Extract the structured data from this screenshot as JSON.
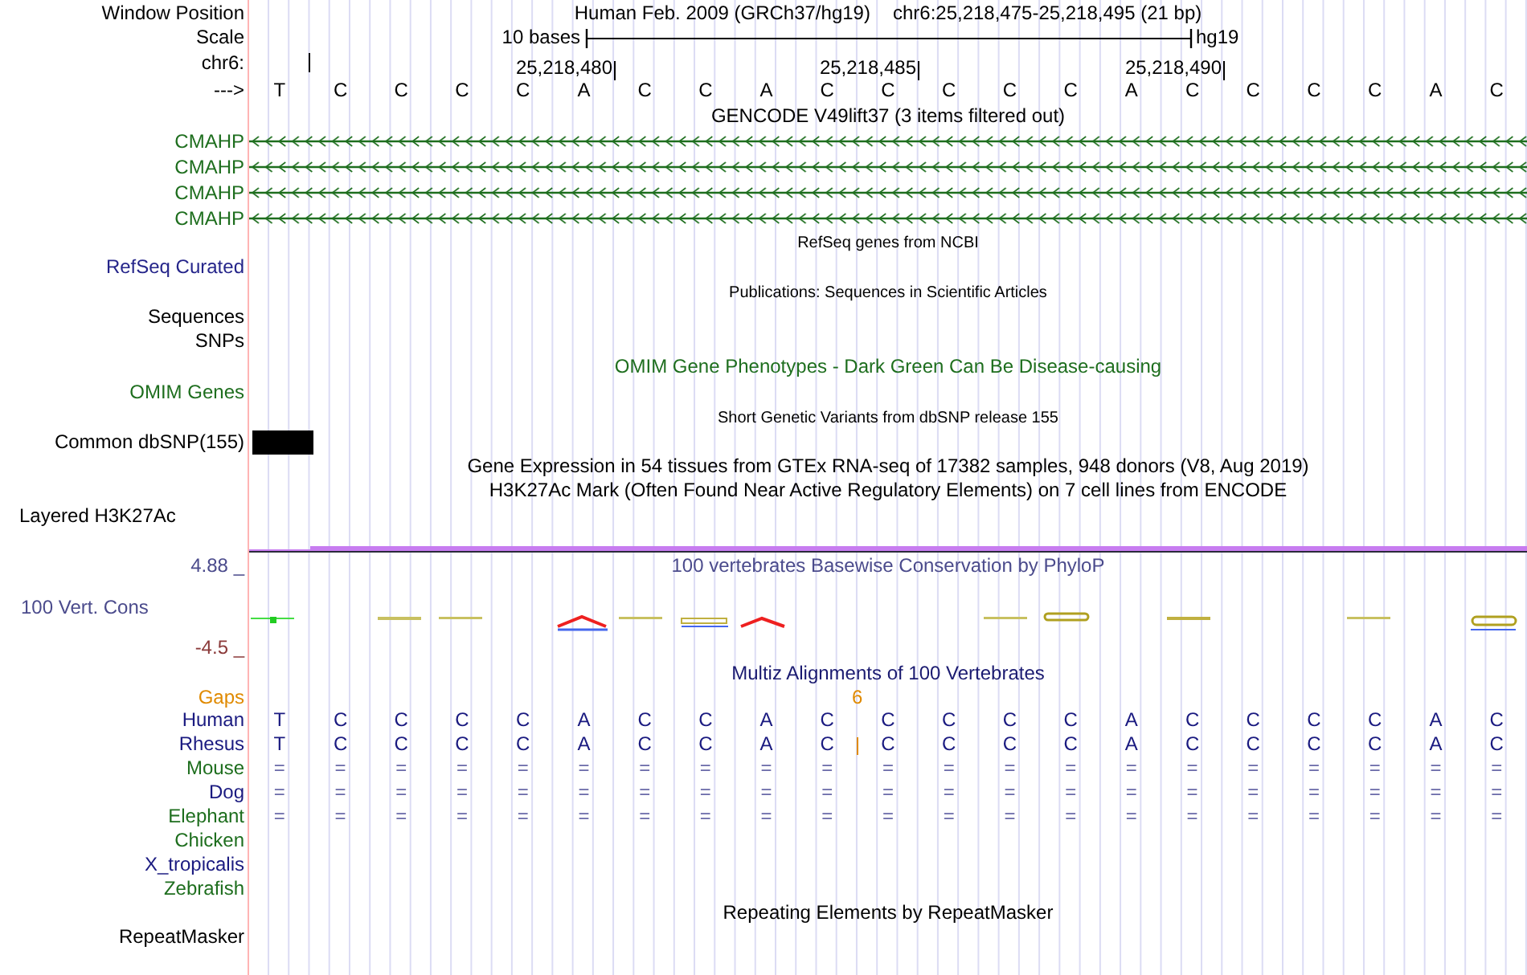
{
  "ruler": {
    "labels": [
      "Window Position",
      "Scale",
      "chr6:",
      "--->"
    ],
    "title": "Human Feb. 2009 (GRCh37/hg19)",
    "position": "chr6:25,218,475-25,218,495 (21 bp)",
    "scale_text": "10 bases",
    "assembly": "hg19",
    "ticks": [
      "25,218,480",
      "25,218,485",
      "25,218,490"
    ],
    "bases": [
      "T",
      "C",
      "C",
      "C",
      "C",
      "A",
      "C",
      "C",
      "A",
      "C",
      "C",
      "C",
      "C",
      "C",
      "A",
      "C",
      "C",
      "C",
      "C",
      "A",
      "C"
    ]
  },
  "gencode": {
    "title": "GENCODE V49lift37 (3 items filtered out)",
    "genes": [
      {
        "name": "CMAHP"
      },
      {
        "name": "CMAHP"
      },
      {
        "name": "CMAHP"
      },
      {
        "name": "CMAHP"
      }
    ]
  },
  "refseq": {
    "title": "RefSeq genes from NCBI",
    "label": "RefSeq Curated"
  },
  "publications": {
    "title": "Publications: Sequences in Scientific Articles",
    "labels": [
      "Sequences",
      "SNPs"
    ]
  },
  "omim": {
    "title": "OMIM Gene Phenotypes - Dark Green Can Be Disease-causing",
    "label": "OMIM Genes"
  },
  "dbsnp": {
    "title": "Short Genetic Variants from dbSNP release 155",
    "label": "Common dbSNP(155)"
  },
  "gtex": {
    "title": "Gene Expression in 54 tissues from GTEx RNA-seq of 17382 samples, 948 donors (V8, Aug 2019)"
  },
  "h3k27ac": {
    "title": "H3K27Ac Mark (Often Found Near Active Regulatory Elements) on 7 cell lines from ENCODE",
    "label": "Layered H3K27Ac"
  },
  "conservation": {
    "title": "100 vertebrates Basewise Conservation by PhyloP",
    "label": "100 Vert. Cons",
    "max": "4.88 _",
    "min": "-4.5 _"
  },
  "multiz": {
    "title": "Multiz Alignments of 100 Vertebrates",
    "gaps_label": "Gaps",
    "gap_count": "6",
    "species": [
      {
        "name": "Human",
        "color": "#1a1a80",
        "kind": "bases",
        "insertion": false,
        "bases": [
          "T",
          "C",
          "C",
          "C",
          "C",
          "A",
          "C",
          "C",
          "A",
          "C",
          "C",
          "C",
          "C",
          "C",
          "A",
          "C",
          "C",
          "C",
          "C",
          "A",
          "C"
        ]
      },
      {
        "name": "Rhesus",
        "color": "#1a1a80",
        "kind": "bases",
        "insertion": true,
        "bases": [
          "T",
          "C",
          "C",
          "C",
          "C",
          "A",
          "C",
          "C",
          "A",
          "C",
          "C",
          "C",
          "C",
          "C",
          "A",
          "C",
          "C",
          "C",
          "C",
          "A",
          "C"
        ]
      },
      {
        "name": "Mouse",
        "color": "#1e6e1e",
        "kind": "bases",
        "insertion": false,
        "bases": [
          "=",
          "=",
          "=",
          "=",
          "=",
          "=",
          "=",
          "=",
          "=",
          "=",
          "=",
          "=",
          "=",
          "=",
          "=",
          "=",
          "=",
          "=",
          "=",
          "=",
          "="
        ]
      },
      {
        "name": "Dog",
        "color": "#1a1a80",
        "kind": "bases",
        "insertion": false,
        "bases": [
          "=",
          "=",
          "=",
          "=",
          "=",
          "=",
          "=",
          "=",
          "=",
          "=",
          "=",
          "=",
          "=",
          "=",
          "=",
          "=",
          "=",
          "=",
          "=",
          "=",
          "="
        ]
      },
      {
        "name": "Elephant",
        "color": "#1e6e1e",
        "kind": "bases",
        "insertion": false,
        "bases": [
          "=",
          "=",
          "=",
          "=",
          "=",
          "=",
          "=",
          "=",
          "=",
          "=",
          "=",
          "=",
          "=",
          "=",
          "=",
          "=",
          "=",
          "=",
          "=",
          "=",
          "="
        ]
      },
      {
        "name": "Chicken",
        "color": "#1e6e1e",
        "kind": "empty",
        "insertion": false
      },
      {
        "name": "X_tropicalis",
        "color": "#1a1a80",
        "kind": "empty",
        "insertion": false
      },
      {
        "name": "Zebrafish",
        "color": "#1e6e1e",
        "kind": "empty",
        "insertion": false
      }
    ]
  },
  "repeatmasker": {
    "title": "Repeating Elements by RepeatMasker",
    "label": "RepeatMasker"
  }
}
